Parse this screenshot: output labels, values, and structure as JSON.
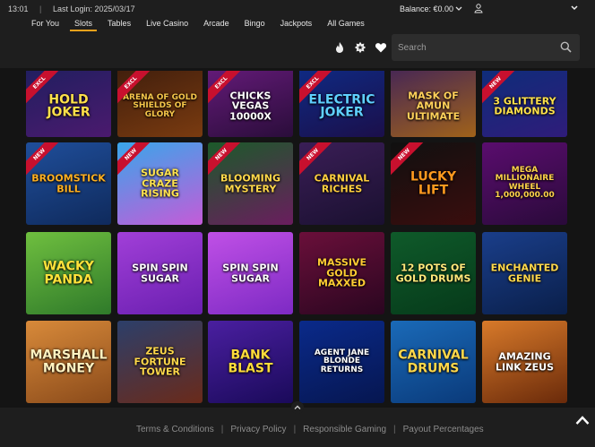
{
  "topbar": {
    "time": "13:01",
    "separator": "|",
    "last_login": "Last Login: 2025/03/17",
    "balance": "Balance: €0.00"
  },
  "nav": {
    "tabs": [
      {
        "label": "For You",
        "active": false
      },
      {
        "label": "Slots",
        "active": true
      },
      {
        "label": "Tables",
        "active": false
      },
      {
        "label": "Live Casino",
        "active": false
      },
      {
        "label": "Arcade",
        "active": false
      },
      {
        "label": "Bingo",
        "active": false
      },
      {
        "label": "Jackpots",
        "active": false
      },
      {
        "label": "All Games",
        "active": false
      }
    ],
    "icons": [
      "flame-icon",
      "star-badge-icon",
      "heart-icon"
    ],
    "search": {
      "placeholder": "Search",
      "value": ""
    }
  },
  "games": [
    {
      "title": "HOLD JOKER",
      "badge": "EXCL",
      "bg": [
        "#1b1f5e",
        "#4b1a6e"
      ],
      "fg": "#ffe04a"
    },
    {
      "title": "ARENA OF GOLD SHIELDS OF GLORY",
      "badge": "EXCL",
      "bg": [
        "#3a1b0c",
        "#7a3b10"
      ],
      "fg": "#f5c64a"
    },
    {
      "title": "CHICKS VEGAS 10000X",
      "badge": "EXCL",
      "bg": [
        "#6b1c80",
        "#2a0d3a"
      ],
      "fg": "#ffffff"
    },
    {
      "title": "ELECTRIC JOKER",
      "badge": "EXCL",
      "bg": [
        "#0d2d8a",
        "#1b0f4a"
      ],
      "fg": "#5fd0ff"
    },
    {
      "title": "MASK OF AMUN ULTIMATE",
      "badge": "",
      "bg": [
        "#3b1f5c",
        "#a0621a"
      ],
      "fg": "#ffd15a"
    },
    {
      "title": "3 GLITTERY DIAMONDS",
      "badge": "NEW",
      "bg": [
        "#0a2f7a",
        "#2f1c7a"
      ],
      "fg": "#ffe14a"
    },
    {
      "title": "BROOMSTICK BILL",
      "badge": "NEW",
      "bg": [
        "#1f4e9a",
        "#0f2a5c"
      ],
      "fg": "#ffb020"
    },
    {
      "title": "SUGAR CRAZE RISING",
      "badge": "NEW",
      "bg": [
        "#39a6ea",
        "#c45bd8"
      ],
      "fg": "#ffe34f"
    },
    {
      "title": "BLOOMING MYSTERY",
      "badge": "NEW",
      "bg": [
        "#1c5a2a",
        "#6a1d5e"
      ],
      "fg": "#ffd84a"
    },
    {
      "title": "CARNIVAL RICHES",
      "badge": "NEW",
      "bg": [
        "#3a1e56",
        "#1a1030"
      ],
      "fg": "#ffcf3f"
    },
    {
      "title": "LUCKY LIFT",
      "badge": "NEW",
      "bg": [
        "#101010",
        "#3a0d0d"
      ],
      "fg": "#ff9a1f"
    },
    {
      "title": "MEGA MILLIONAIRE WHEEL 1,000,000.00",
      "badge": "",
      "bg": [
        "#5a0d6e",
        "#2a0a3a"
      ],
      "fg": "#ffd44a"
    },
    {
      "title": "WACKY PANDA",
      "badge": "",
      "bg": [
        "#6fbf3f",
        "#2f7a2a"
      ],
      "fg": "#ffe23a"
    },
    {
      "title": "SPIN SPIN SUGAR",
      "badge": "",
      "bg": [
        "#a13fd8",
        "#6a1fb0"
      ],
      "fg": "#ffffff"
    },
    {
      "title": "SPIN SPIN SUGAR",
      "badge": "",
      "bg": [
        "#c050e6",
        "#7d2ac4"
      ],
      "fg": "#ffffff"
    },
    {
      "title": "MASSIVE GOLD MAXXED",
      "badge": "",
      "bg": [
        "#6a0f3a",
        "#2a0620"
      ],
      "fg": "#ffcc33"
    },
    {
      "title": "12 POTS OF GOLD DRUMS",
      "badge": "",
      "bg": [
        "#0f5a2a",
        "#063a1a"
      ],
      "fg": "#ffe87a"
    },
    {
      "title": "ENCHANTED GENIE",
      "badge": "",
      "bg": [
        "#1a3e8a",
        "#0a1f4a"
      ],
      "fg": "#ffd84a"
    },
    {
      "title": "MARSHALL MONEY",
      "badge": "",
      "bg": [
        "#d88a3a",
        "#8a4a1a"
      ],
      "fg": "#fff2c0"
    },
    {
      "title": "ZEUS FORTUNE TOWER",
      "badge": "",
      "bg": [
        "#2c3f6a",
        "#6a2a1a"
      ],
      "fg": "#ffd84a"
    },
    {
      "title": "BANK BLAST",
      "badge": "",
      "bg": [
        "#4a1fa0",
        "#1a0a5a"
      ],
      "fg": "#ffdc3a"
    },
    {
      "title": "AGENT JANE BLONDE RETURNS",
      "badge": "",
      "bg": [
        "#0a2a8a",
        "#061650"
      ],
      "fg": "#ffffff"
    },
    {
      "title": "CARNIVAL DRUMS",
      "badge": "",
      "bg": [
        "#1a6ab8",
        "#0a3a7a"
      ],
      "fg": "#ffd84a"
    },
    {
      "title": "AMAZING LINK ZEUS",
      "badge": "",
      "bg": [
        "#d87a2a",
        "#6a2a0a"
      ],
      "fg": "#ffffff"
    }
  ],
  "footer": {
    "links": [
      "Terms & Conditions",
      "Privacy Policy",
      "Responsible Gaming",
      "Payout Percentages"
    ],
    "separator": "|"
  }
}
